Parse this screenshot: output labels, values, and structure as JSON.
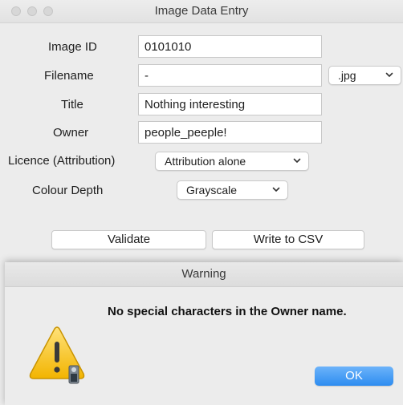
{
  "main_window": {
    "title": "Image Data Entry",
    "fields": {
      "image_id": {
        "label": "Image ID",
        "value": "0101010"
      },
      "filename": {
        "label": "Filename",
        "value": "-",
        "extension": ".jpg"
      },
      "title": {
        "label": "Title",
        "value": "Nothing interesting"
      },
      "owner": {
        "label": "Owner",
        "value": "people_peeple!"
      },
      "licence": {
        "label": "Licence (Attribution)",
        "selected": "Attribution alone"
      },
      "colour_depth": {
        "label": "Colour Depth",
        "selected": "Grayscale"
      }
    },
    "buttons": {
      "validate": "Validate",
      "write_csv": "Write to CSV"
    }
  },
  "warning_dialog": {
    "title": "Warning",
    "message": "No special characters in the Owner name.",
    "ok_label": "OK",
    "icon": "warning-triangle-icon",
    "accent_color": "#2d8cf0"
  }
}
